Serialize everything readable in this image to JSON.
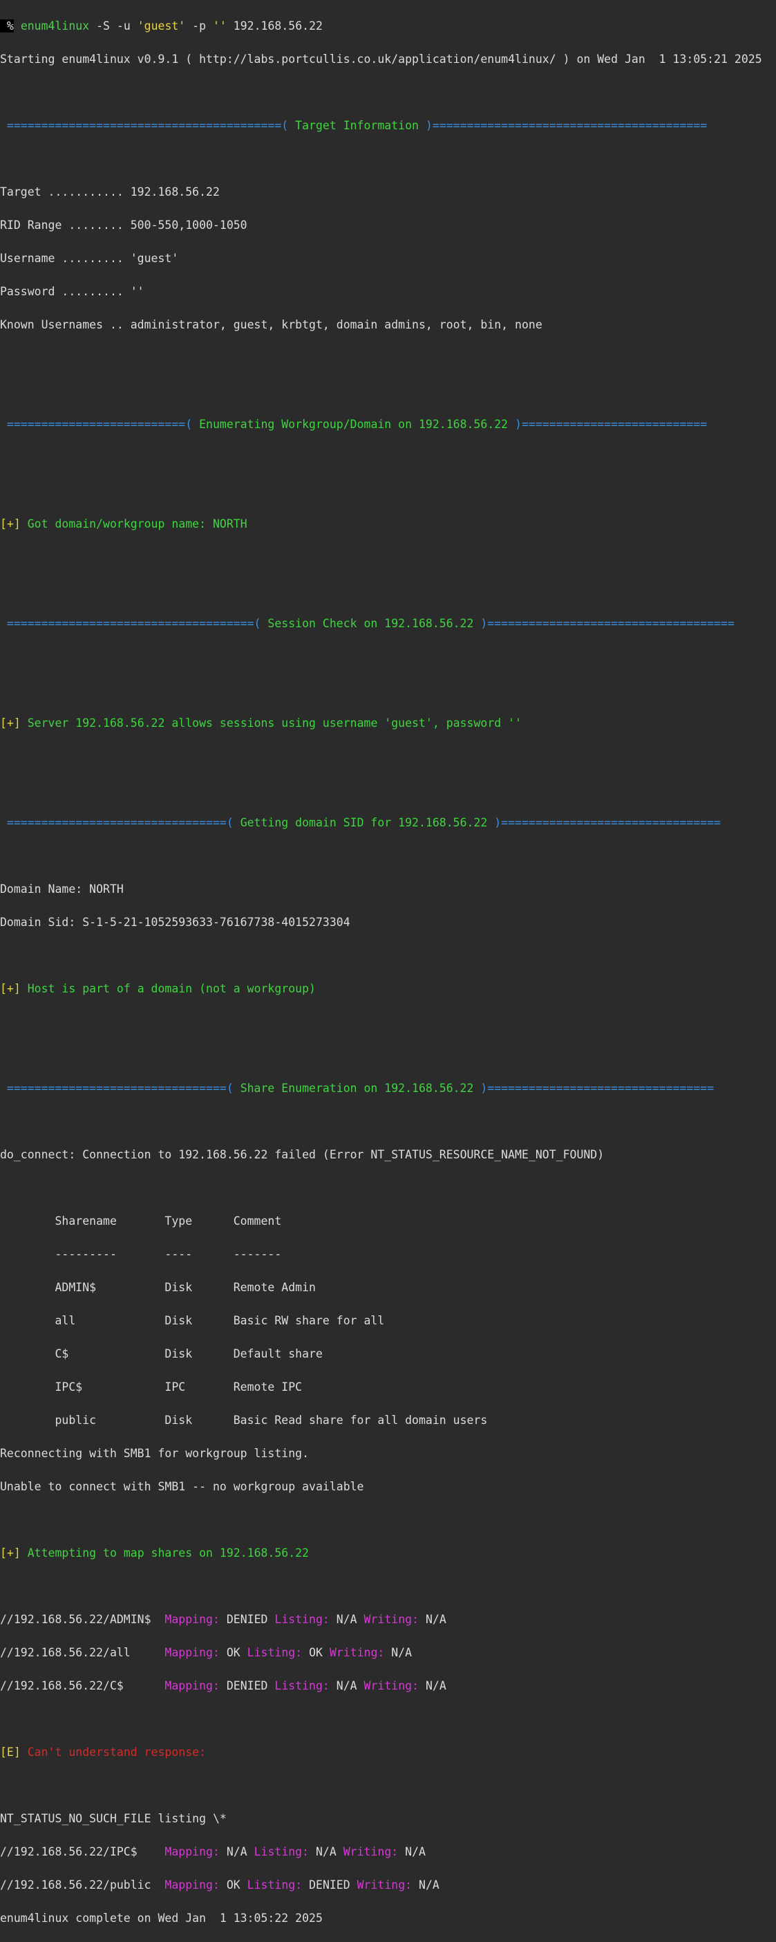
{
  "prompt": {
    "symbol": " %",
    "program": "enum4linux",
    "args_a": " -S -u ",
    "user_arg": "'guest'",
    "args_b": " -p ",
    "pass_arg": "''",
    "target": " 192.168.56.22"
  },
  "starting_line": "Starting enum4linux v0.9.1 ( http://labs.portcullis.co.uk/application/enum4linux/ ) on Wed Jan  1 13:05:21 2025",
  "sections": {
    "target_info": {
      "left": " ========================================( ",
      "title": "Target Information",
      "right": " )========================================"
    },
    "workgroup": {
      "left": " ==========================( ",
      "title": "Enumerating Workgroup/Domain on 192.168.56.22",
      "right": " )==========================="
    },
    "session": {
      "left": " ====================================( ",
      "title": "Session Check on 192.168.56.22",
      "right": " )===================================="
    },
    "domain_sid": {
      "left": " ================================( ",
      "title": "Getting domain SID for 192.168.56.22",
      "right": " )================================"
    },
    "shares": {
      "left": " ================================( ",
      "title": "Share Enumeration on 192.168.56.22",
      "right": " )================================="
    }
  },
  "target_info": {
    "target": "Target ........... 192.168.56.22",
    "rid_range": "RID Range ........ 500-550,1000-1050",
    "username": "Username ......... 'guest'",
    "password": "Password ......... ''",
    "known_usernames": "Known Usernames .. administrator, guest, krbtgt, domain admins, root, bin, none"
  },
  "plus_marker": "[+]",
  "error_marker": "[E]",
  "workgroup_result": " Got domain/workgroup name: NORTH",
  "session_result": " Server 192.168.56.22 allows sessions using username 'guest', password ''",
  "domain": {
    "name": "Domain Name: NORTH",
    "sid": "Domain Sid: S-1-5-21-1052593633-76167738-4015273304",
    "membership": " Host is part of a domain (not a workgroup)"
  },
  "connect_error": "do_connect: Connection to 192.168.56.22 failed (Error NT_STATUS_RESOURCE_NAME_NOT_FOUND)",
  "share_table": {
    "header": "        Sharename       Type      Comment",
    "divider": "        ---------       ----      -------",
    "rows": [
      "        ADMIN$          Disk      Remote Admin",
      "        all             Disk      Basic RW share for all",
      "        C$              Disk      Default share",
      "        IPC$            IPC       Remote IPC",
      "        public          Disk      Basic Read share for all domain users"
    ]
  },
  "smb1_reconnect": "Reconnecting with SMB1 for workgroup listing.",
  "smb1_unavailable": "Unable to connect with SMB1 -- no workgroup available",
  "map_attempt": " Attempting to map shares on 192.168.56.22",
  "labels": {
    "mapping": "Mapping:",
    "listing": "Listing:",
    "writing": "Writing:"
  },
  "mappings": [
    {
      "path": "//192.168.56.22/ADMIN$  ",
      "mapping": " DENIED ",
      "listing": " N/A ",
      "writing": " N/A"
    },
    {
      "path": "//192.168.56.22/all     ",
      "mapping": " OK ",
      "listing": " OK ",
      "writing": " N/A"
    },
    {
      "path": "//192.168.56.22/C$      ",
      "mapping": " DENIED ",
      "listing": " N/A ",
      "writing": " N/A"
    },
    {
      "path": "//192.168.56.22/IPC$    ",
      "mapping": " N/A ",
      "listing": " N/A ",
      "writing": " N/A"
    },
    {
      "path": "//192.168.56.22/public  ",
      "mapping": " OK ",
      "listing": " DENIED ",
      "writing": " N/A"
    }
  ],
  "error_text": " Can't understand response:",
  "no_such_file": "NT_STATUS_NO_SUCH_FILE listing \\*",
  "complete_line": "enum4linux complete on Wed Jan  1 13:05:22 2025"
}
